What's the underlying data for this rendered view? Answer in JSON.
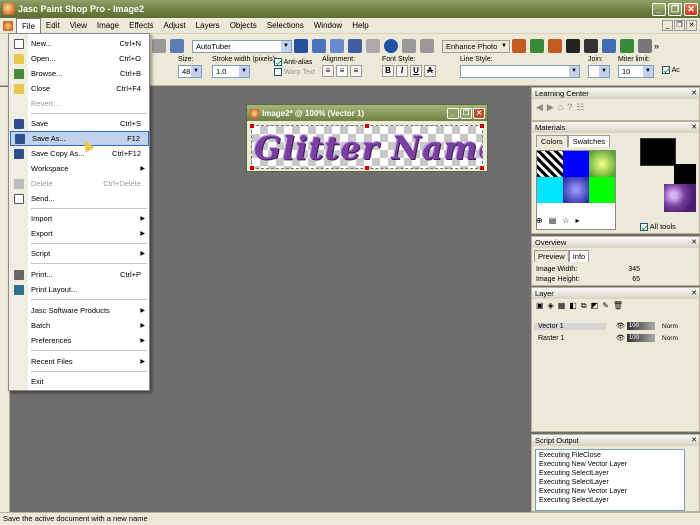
{
  "window": {
    "title": "Jasc Paint Shop Pro - Image2"
  },
  "menubar": [
    "File",
    "Edit",
    "View",
    "Image",
    "Effects",
    "Adjust",
    "Layers",
    "Objects",
    "Selections",
    "Window",
    "Help"
  ],
  "toolbar": {
    "preset": "AutoTuber",
    "enhance_photo": "Enhance Photo",
    "size_label": "Size:",
    "size_value": "48",
    "stroke_label": "Stroke width (pixels):",
    "stroke_value": "1.0",
    "antialias_label": "Anti-alias",
    "warp_label": "Warp Text",
    "alignment_label": "Alignment:",
    "font_style_label": "Font Style:",
    "line_style_label": "Line Style:",
    "join_label": "Join:",
    "miter_label": "Miter limit:",
    "miter_value": "10",
    "bold": "B",
    "italic": "I",
    "underline": "U",
    "strike": "A",
    "trailing": "Ac"
  },
  "file_menu": {
    "items": [
      {
        "label": "New...",
        "shortcut": "Ctrl+N",
        "icon": "new-doc"
      },
      {
        "label": "Open...",
        "shortcut": "Ctrl+O",
        "icon": "open-folder"
      },
      {
        "label": "Browse...",
        "shortcut": "Ctrl+B",
        "icon": "browse"
      },
      {
        "label": "Close",
        "shortcut": "Ctrl+F4",
        "icon": "close-doc"
      },
      {
        "label": "Revert...",
        "shortcut": "",
        "icon": "",
        "disabled": true
      },
      {
        "label": "Save",
        "shortcut": "Ctrl+S",
        "icon": "save"
      },
      {
        "label": "Save As...",
        "shortcut": "F12",
        "icon": "save-as",
        "highlighted": true
      },
      {
        "label": "Save Copy As...",
        "shortcut": "Ctrl+F12",
        "icon": "save-copy"
      },
      {
        "label": "Workspace",
        "shortcut": "",
        "submenu": true
      },
      {
        "label": "Delete",
        "shortcut": "Ctrl+Delete",
        "icon": "delete",
        "disabled": true
      },
      {
        "label": "Send...",
        "shortcut": "",
        "icon": "send"
      },
      {
        "label": "Import",
        "shortcut": "",
        "submenu": true
      },
      {
        "label": "Export",
        "shortcut": "",
        "submenu": true
      },
      {
        "label": "Script",
        "shortcut": "",
        "submenu": true
      },
      {
        "label": "Print...",
        "shortcut": "Ctrl+P",
        "icon": "print"
      },
      {
        "label": "Print Layout...",
        "shortcut": "",
        "icon": "print-layout"
      },
      {
        "label": "Jasc Software Products",
        "shortcut": "",
        "submenu": true
      },
      {
        "label": "Batch",
        "shortcut": "",
        "submenu": true
      },
      {
        "label": "Preferences",
        "shortcut": "",
        "submenu": true
      },
      {
        "label": "Recent Files",
        "shortcut": "",
        "submenu": true
      },
      {
        "label": "Exit",
        "shortcut": ""
      }
    ]
  },
  "image_window": {
    "title": "Image2* @ 100% (Vector 1)",
    "canvas_text": "Glitter Name"
  },
  "learning_center": {
    "title": "Learning Center"
  },
  "materials": {
    "title": "Materials",
    "tab_colors": "Colors",
    "tab_swatches": "Swatches",
    "all_tools": "All tools",
    "swatch_colors": [
      "#333333",
      "#0000ff",
      "#9acd32",
      "#00e5ff",
      "#1e1e9a",
      "#00ff00",
      "#ffffff",
      "#ffffff",
      "#ffffff"
    ]
  },
  "overview": {
    "title": "Overview",
    "tab_preview": "Preview",
    "tab_info": "Info",
    "width_label": "Image Width:",
    "width_value": "345",
    "height_label": "Image Height:",
    "height_value": "65"
  },
  "layers": {
    "title": "Layer",
    "rows": [
      {
        "name": "Vector 1",
        "opacity": "100",
        "blend": "Norm",
        "selected": true
      },
      {
        "name": "Raster 1",
        "opacity": "100",
        "blend": "Norm",
        "selected": false
      }
    ]
  },
  "script_output": {
    "title": "Script Output",
    "lines": [
      "Executing FileClose",
      "Executing New Vector Layer",
      "Executing SelectLayer",
      "Executing SelectLayer",
      "Executing New Vector Layer",
      "Executing SelectLayer"
    ]
  },
  "status": "Save the active document with a new name"
}
